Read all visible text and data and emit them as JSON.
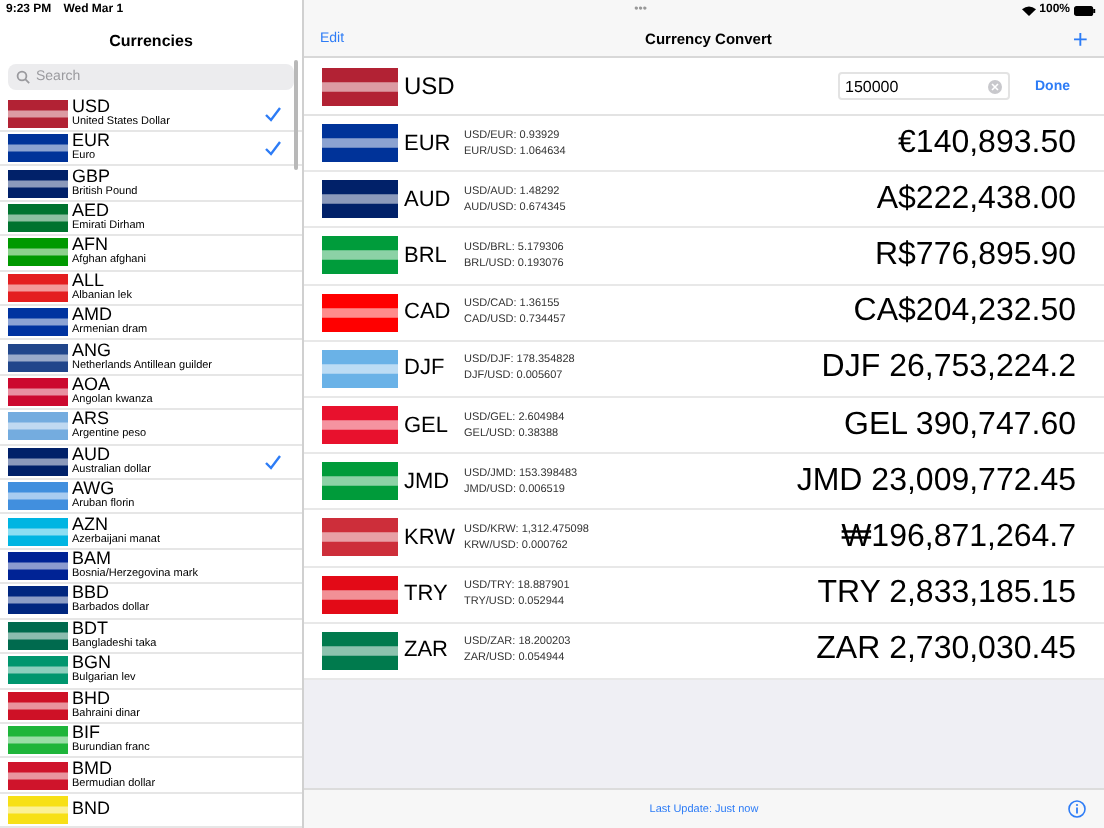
{
  "status_bar": {
    "time": "9:23 PM",
    "date": "Wed Mar 1",
    "dots": "•••",
    "battery": "100%"
  },
  "sidebar": {
    "title": "Currencies",
    "search": {
      "placeholder": "Search"
    },
    "items": [
      {
        "code": "USD",
        "name": "United States Dollar",
        "checked": true,
        "color": "#b22234"
      },
      {
        "code": "EUR",
        "name": "Euro",
        "checked": true,
        "color": "#003399"
      },
      {
        "code": "GBP",
        "name": "British Pound",
        "checked": false,
        "color": "#012169"
      },
      {
        "code": "AED",
        "name": "Emirati Dirham",
        "checked": false,
        "color": "#00732f"
      },
      {
        "code": "AFN",
        "name": "Afghan afghani",
        "checked": false,
        "color": "#009900"
      },
      {
        "code": "ALL",
        "name": "Albanian lek",
        "checked": false,
        "color": "#e41e20"
      },
      {
        "code": "AMD",
        "name": "Armenian dram",
        "checked": false,
        "color": "#0033a0"
      },
      {
        "code": "ANG",
        "name": "Netherlands Antillean guilder",
        "checked": false,
        "color": "#21468b"
      },
      {
        "code": "AOA",
        "name": "Angolan kwanza",
        "checked": false,
        "color": "#cc092f"
      },
      {
        "code": "ARS",
        "name": "Argentine peso",
        "checked": false,
        "color": "#74acdf"
      },
      {
        "code": "AUD",
        "name": "Australian dollar",
        "checked": true,
        "color": "#012169"
      },
      {
        "code": "AWG",
        "name": "Aruban florin",
        "checked": false,
        "color": "#418fde"
      },
      {
        "code": "AZN",
        "name": "Azerbaijani manat",
        "checked": false,
        "color": "#00b5e2"
      },
      {
        "code": "BAM",
        "name": "Bosnia/Herzegovina mark",
        "checked": false,
        "color": "#002395"
      },
      {
        "code": "BBD",
        "name": "Barbados dollar",
        "checked": false,
        "color": "#00267f"
      },
      {
        "code": "BDT",
        "name": "Bangladeshi taka",
        "checked": false,
        "color": "#006a4e"
      },
      {
        "code": "BGN",
        "name": "Bulgarian lev",
        "checked": false,
        "color": "#00966e"
      },
      {
        "code": "BHD",
        "name": "Bahraini dinar",
        "checked": false,
        "color": "#ce1126"
      },
      {
        "code": "BIF",
        "name": "Burundian franc",
        "checked": false,
        "color": "#1eb53a"
      },
      {
        "code": "BMD",
        "name": "Bermudian dollar",
        "checked": false,
        "color": "#cf142b"
      },
      {
        "code": "BND",
        "checked": false,
        "color": "#f7e017"
      }
    ]
  },
  "converter": {
    "edit": "Edit",
    "title": "Currency Convert",
    "add": "+",
    "base": {
      "code": "USD",
      "value": "150000",
      "done": "Done",
      "color": "#b22234"
    },
    "rows": [
      {
        "code": "EUR",
        "rates": [
          "USD/EUR: 0.93929",
          "EUR/USD: 1.064634"
        ],
        "amount": "€140,893.50",
        "color": "#003399"
      },
      {
        "code": "AUD",
        "rates": [
          "USD/AUD: 1.48292",
          "AUD/USD: 0.674345"
        ],
        "amount": "A$222,438.00",
        "color": "#012169"
      },
      {
        "code": "BRL",
        "rates": [
          "USD/BRL: 5.179306",
          "BRL/USD: 0.193076"
        ],
        "amount": "R$776,895.90",
        "color": "#009c3b"
      },
      {
        "code": "CAD",
        "rates": [
          "USD/CAD: 1.36155",
          "CAD/USD: 0.734457"
        ],
        "amount": "CA$204,232.50",
        "color": "#ff0000"
      },
      {
        "code": "DJF",
        "rates": [
          "USD/DJF: 178.354828",
          "DJF/USD: 0.005607"
        ],
        "amount": "DJF 26,753,224.2",
        "color": "#6ab2e7"
      },
      {
        "code": "GEL",
        "rates": [
          "USD/GEL: 2.604984",
          "GEL/USD: 0.38388"
        ],
        "amount": "GEL 390,747.60",
        "color": "#e8112d"
      },
      {
        "code": "JMD",
        "rates": [
          "USD/JMD: 153.398483",
          "JMD/USD: 0.006519"
        ],
        "amount": "JMD 23,009,772.45",
        "color": "#009b3a"
      },
      {
        "code": "KRW",
        "rates": [
          "USD/KRW: 1,312.475098",
          "KRW/USD: 0.000762"
        ],
        "amount": "₩196,871,264.7",
        "color": "#cd2e3a"
      },
      {
        "code": "TRY",
        "rates": [
          "USD/TRY: 18.887901",
          "TRY/USD: 0.052944"
        ],
        "amount": "TRY 2,833,185.15",
        "color": "#e30a17"
      },
      {
        "code": "ZAR",
        "rates": [
          "USD/ZAR: 18.200203",
          "ZAR/USD: 0.054944"
        ],
        "amount": "ZAR 2,730,030.45",
        "color": "#007a4d"
      }
    ],
    "footer": "Last Update: Just now"
  }
}
